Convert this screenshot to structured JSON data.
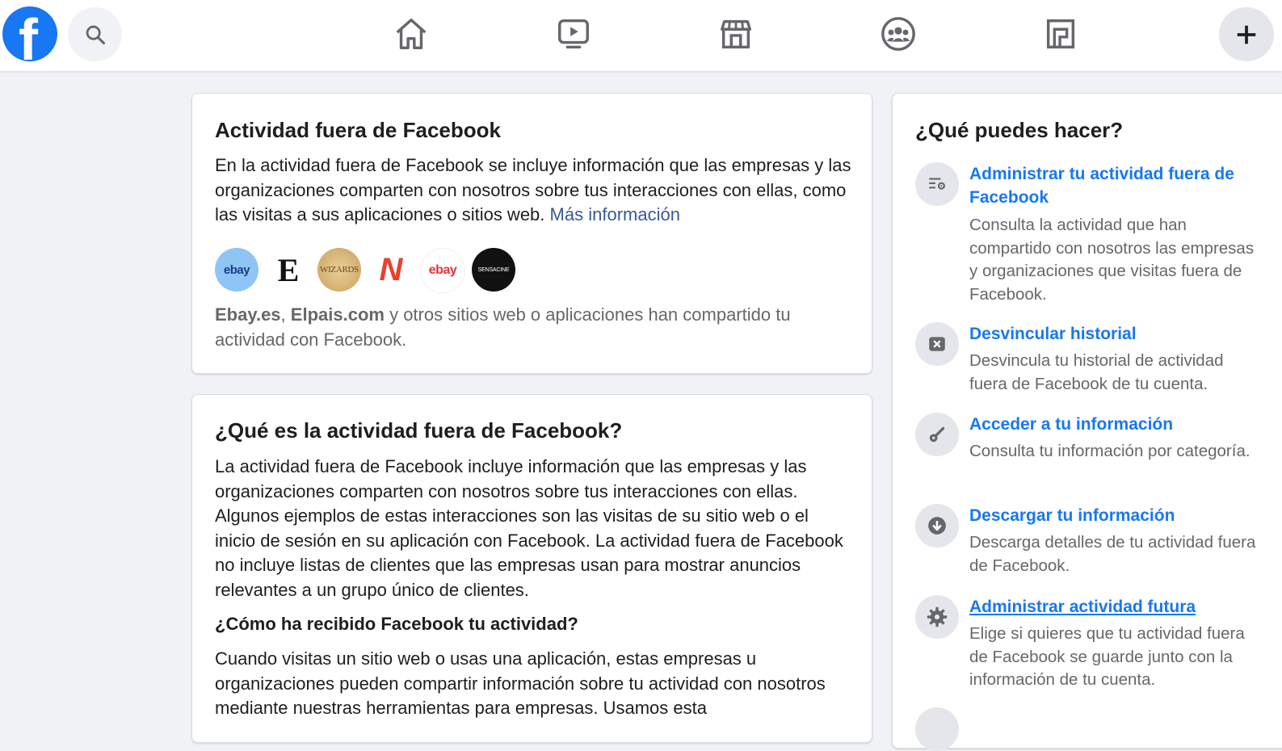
{
  "nav": {
    "logo_letter": "f",
    "icons": [
      "search-icon",
      "home-icon",
      "watch-icon",
      "marketplace-icon",
      "groups-icon",
      "gaming-icon",
      "plus-icon"
    ]
  },
  "card1": {
    "title": "Actividad fuera de Facebook",
    "intro": "En la actividad fuera de Facebook se incluye información que las empresas y las organizaciones comparten con nosotros sobre tus interacciones con ellas, como las visitas a sus aplicaciones o sitios web.",
    "more_link": "Más información",
    "logos": [
      {
        "name": "ebay",
        "text": "ebay",
        "bg": "#8ec5f5"
      },
      {
        "name": "elpais",
        "text": "E",
        "bg": "#ffffff"
      },
      {
        "name": "wizards",
        "text": "WIZARDS",
        "bg": "#d8b779"
      },
      {
        "name": "n-app",
        "text": "N",
        "bg": "#ffffff"
      },
      {
        "name": "ebay-2",
        "text": "ebay",
        "bg": "#ffffff"
      },
      {
        "name": "sensacine",
        "text": "SENSACINE",
        "bg": "#111111"
      }
    ],
    "summary_site1": "Ebay.es",
    "summary_sep": ",",
    "summary_site2": "Elpais.com",
    "summary_rest": "y otros sitios web o aplicaciones han compartido tu actividad con Facebook."
  },
  "card2": {
    "title": "¿Qué es la actividad fuera de Facebook?",
    "para1": "La actividad fuera de Facebook incluye información que las empresas y las organizaciones comparten con nosotros sobre tus interacciones con ellas. Algunos ejemplos de estas interacciones son las visitas de su sitio web o el inicio de sesión en su aplicación con Facebook. La actividad fuera de Facebook no incluye listas de clientes que las empresas usan para mostrar anuncios relevantes a un grupo único de clientes.",
    "subtitle": "¿Cómo ha recibido Facebook tu actividad?",
    "para2": "Cuando visitas un sitio web o usas una aplicación, estas empresas u organizaciones pueden compartir información sobre tu actividad con nosotros mediante nuestras herramientas para empresas. Usamos esta"
  },
  "right": {
    "title": "¿Qué puedes hacer?",
    "items": [
      {
        "icon": "manage-settings-icon",
        "label": "Administrar tu actividad fuera de Facebook",
        "desc": "Consulta la actividad que han compartido con nosotros las empresas y organizaciones que visitas fuera de Facebook."
      },
      {
        "icon": "unlink-icon",
        "label": "Desvincular historial",
        "desc": "Desvincula tu historial de actividad fuera de Facebook de tu cuenta."
      },
      {
        "icon": "key-icon",
        "label": "Acceder a tu información",
        "desc": "Consulta tu información por categoría."
      },
      {
        "icon": "download-icon",
        "label": "Descargar tu información",
        "desc": "Descarga detalles de tu actividad fuera de Facebook."
      },
      {
        "icon": "gear-icon",
        "label": "Administrar actividad futura",
        "desc": "Elige si quieres que tu actividad fuera de Facebook se guarde junto con la información de tu cuenta."
      }
    ]
  },
  "colors": {
    "brand": "#1877f2",
    "link": "#385898",
    "muted": "#65676b",
    "bg": "#f0f2f5"
  }
}
